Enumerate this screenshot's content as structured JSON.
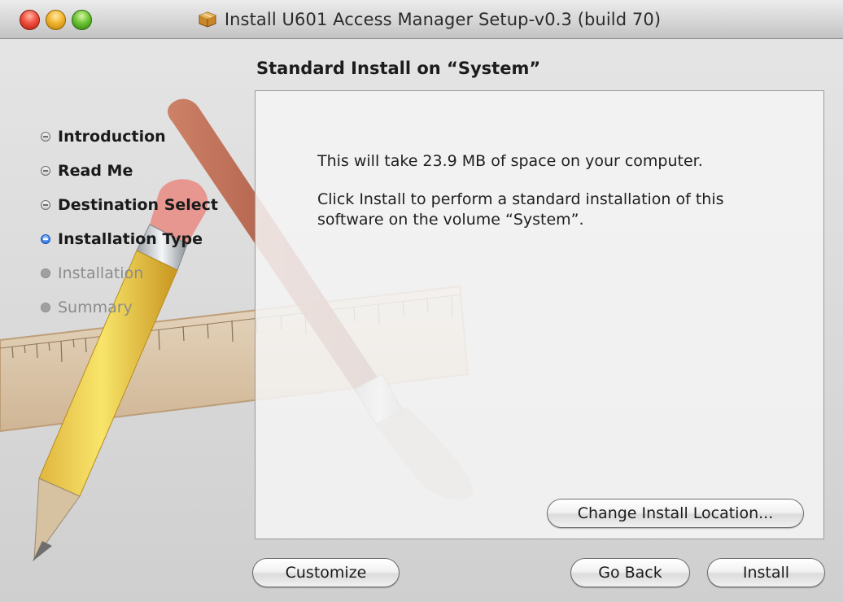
{
  "window": {
    "title": "Install U601 Access Manager Setup-v0.3 (build 70)",
    "title_icon": "package-icon",
    "controls": [
      "close",
      "minimize",
      "zoom"
    ]
  },
  "heading": "Standard Install on “System”",
  "steps": [
    {
      "label": "Introduction",
      "state": "done"
    },
    {
      "label": "Read Me",
      "state": "done"
    },
    {
      "label": "Destination Select",
      "state": "done"
    },
    {
      "label": "Installation Type",
      "state": "current"
    },
    {
      "label": "Installation",
      "state": "future"
    },
    {
      "label": "Summary",
      "state": "future"
    }
  ],
  "content": {
    "space_text": "This will take 23.9 MB of space on your computer.",
    "instruction_text": "Click Install to perform a standard installation of this software on the volume “System”."
  },
  "buttons": {
    "change_location": "Change Install Location...",
    "customize": "Customize",
    "go_back": "Go Back",
    "install": "Install"
  },
  "colors": {
    "current_step": "#2a6de0",
    "close": "#f0503f",
    "minimize": "#f3b52e",
    "zoom": "#6cc534"
  }
}
